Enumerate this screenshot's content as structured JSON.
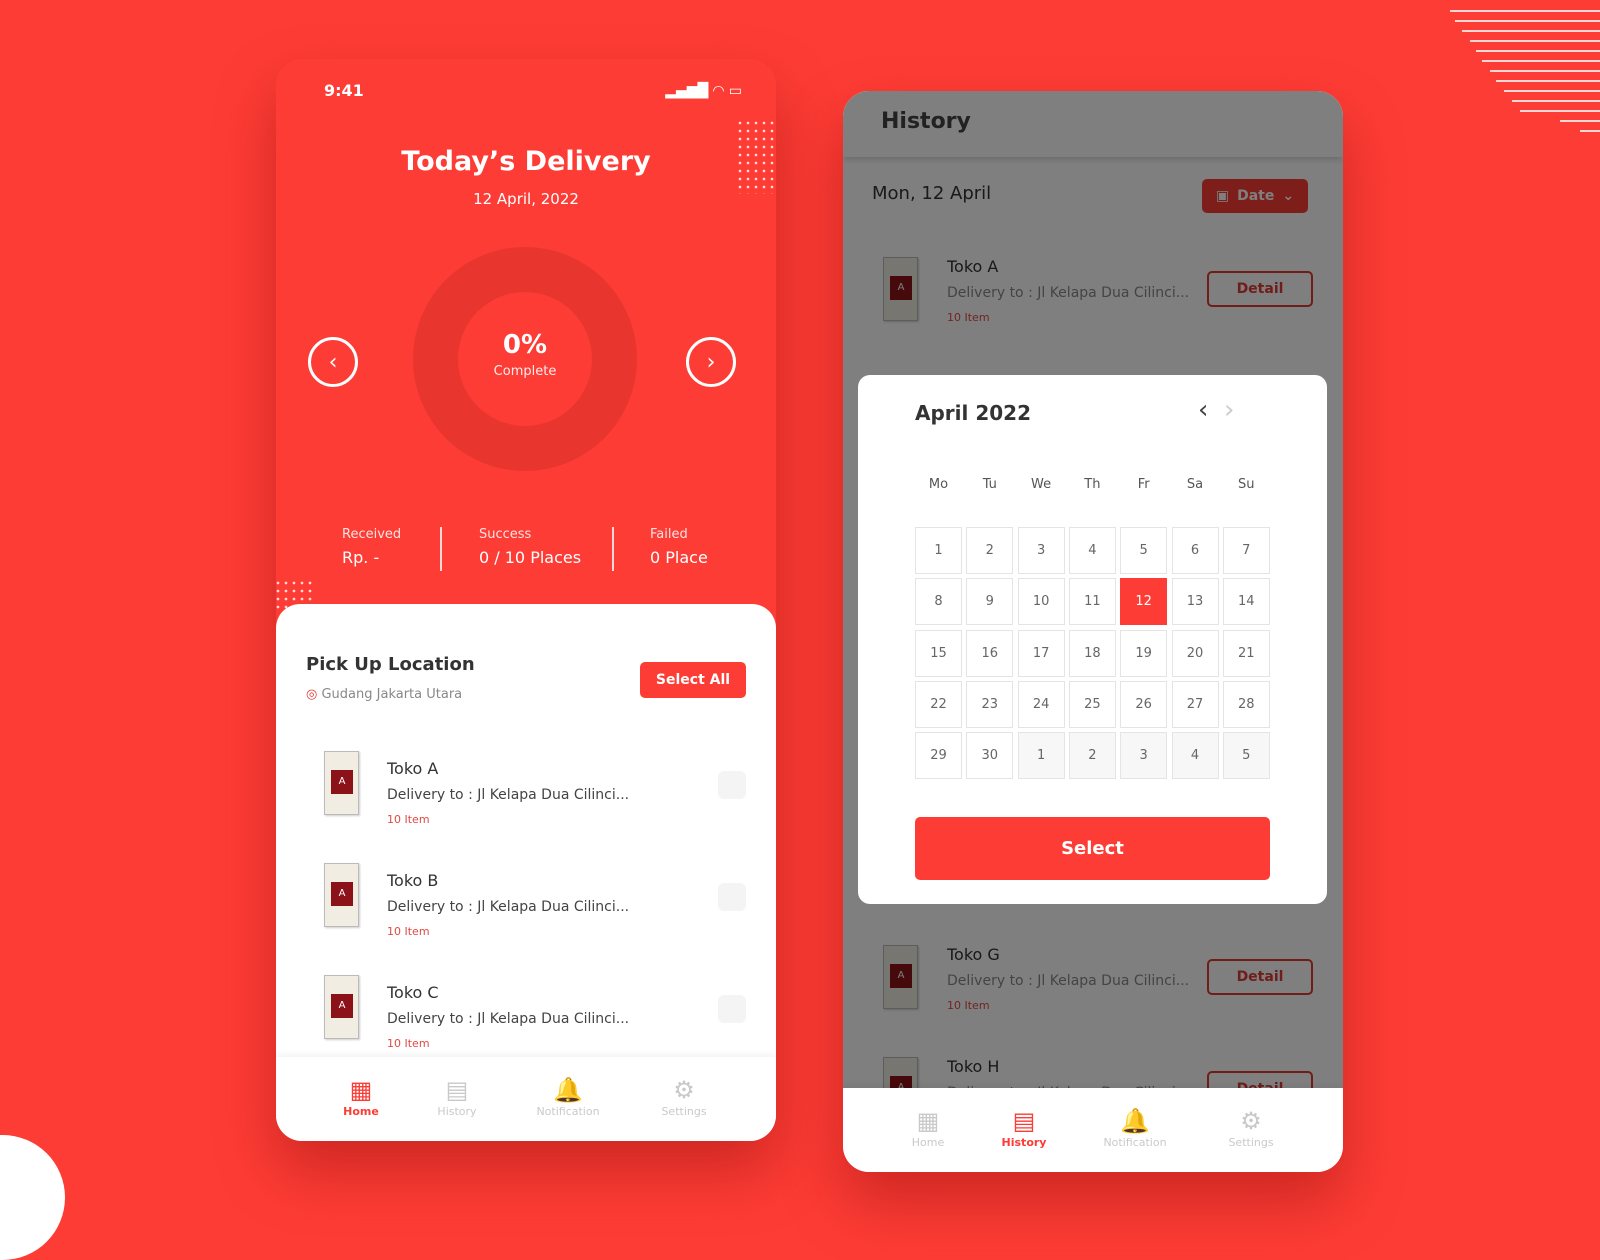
{
  "colors": {
    "accent": "#fd3c35"
  },
  "home": {
    "status_time": "9:41",
    "title": "Today’s Delivery",
    "date": "12 April, 2022",
    "progress": {
      "percent_label": "0%",
      "value": 0,
      "caption": "Complete"
    },
    "stats": [
      {
        "label": "Received",
        "value": "Rp. -"
      },
      {
        "label": "Success",
        "value": "0 / 10 Places"
      },
      {
        "label": "Failed",
        "value": "0 Place"
      }
    ],
    "pickup": {
      "title": "Pick Up Location",
      "location": "Gudang Jakarta Utara",
      "select_all": "Select All"
    },
    "items": [
      {
        "name": "Toko A",
        "address": "Delivery to : Jl Kelapa Dua Cilinci...",
        "count": "10 Item",
        "checked": false
      },
      {
        "name": "Toko B",
        "address": "Delivery to : Jl Kelapa Dua Cilinci...",
        "count": "10 Item",
        "checked": false
      },
      {
        "name": "Toko C",
        "address": "Delivery to : Jl Kelapa Dua Cilinci...",
        "count": "10 Item",
        "checked": false
      }
    ]
  },
  "nav": [
    {
      "label": "Home",
      "icon": "grid-icon"
    },
    {
      "label": "History",
      "icon": "calendar-icon"
    },
    {
      "label": "Notification",
      "icon": "bell-icon"
    },
    {
      "label": "Settings",
      "icon": "gear-icon"
    }
  ],
  "history": {
    "title": "History",
    "day": "Mon, 12 April",
    "date_button": "Date",
    "detail_label": "Detail",
    "items": [
      {
        "name": "Toko A",
        "address": "Delivery to : Jl Kelapa Dua Cilinci...",
        "count": "10 Item"
      },
      {
        "name": "Toko G",
        "address": "Delivery to : Jl Kelapa Dua Cilinci...",
        "count": "10 Item"
      },
      {
        "name": "Toko H",
        "address": "Delivery to : Jl Kelapa Dua Cilinci...",
        "count": ""
      }
    ]
  },
  "calendar": {
    "month": "April 2022",
    "weekdays": [
      "Mo",
      "Tu",
      "We",
      "Th",
      "Fr",
      "Sa",
      "Su"
    ],
    "weeks": [
      [
        "1",
        "2",
        "3",
        "4",
        "5",
        "6",
        "7"
      ],
      [
        "8",
        "9",
        "10",
        "11",
        "12",
        "13",
        "14"
      ],
      [
        "15",
        "16",
        "17",
        "18",
        "19",
        "20",
        "21"
      ],
      [
        "22",
        "23",
        "24",
        "25",
        "26",
        "27",
        "28"
      ],
      [
        "29",
        "30",
        "1",
        "2",
        "3",
        "4",
        "5"
      ]
    ],
    "selected": "12",
    "select_label": "Select"
  }
}
